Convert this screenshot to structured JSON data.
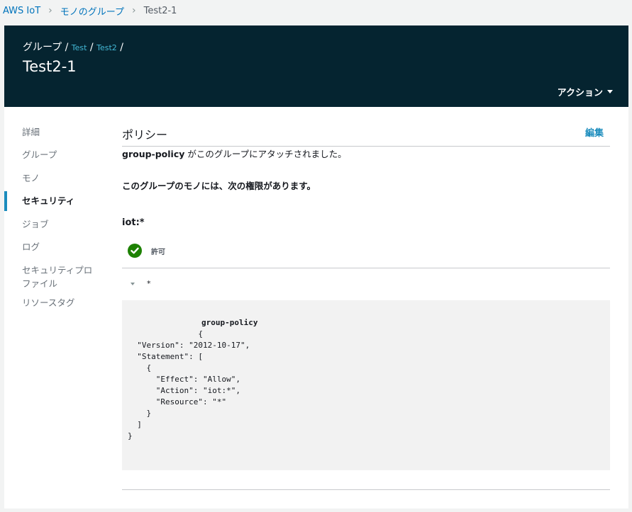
{
  "breadcrumb": {
    "items": [
      "AWS IoT",
      "モノのグループ"
    ],
    "current": "Test2-1"
  },
  "header": {
    "path_root": "グループ",
    "path_links": [
      "Test",
      "Test2"
    ],
    "title": "Test2-1",
    "actions_label": "アクション"
  },
  "sidenav": {
    "items": [
      "詳細",
      "グループ",
      "モノ",
      "セキュリティ",
      "ジョブ",
      "ログ",
      "セキュリティプロファイル",
      "リソースタグ"
    ],
    "active_index": 3
  },
  "policy": {
    "section_title": "ポリシー",
    "edit_label": "編集",
    "attached_name": "group-policy",
    "attached_text": " がこのグループにアタッチされました。",
    "permissions_heading": "このグループのモノには、次の権限があります。",
    "action": "iot:*",
    "effect_label": "許可",
    "resource": "*",
    "document_name": "group-policy",
    "document_body": "{\n  \"Version\": \"2012-10-17\",\n  \"Statement\": [\n    {\n      \"Effect\": \"Allow\",\n      \"Action\": \"iot:*\",\n      \"Resource\": \"*\"\n    }\n  ]\n}"
  },
  "colors": {
    "header_bg": "#052430",
    "link": "#0073bb",
    "active_bar": "#1b8cbd",
    "allow_green": "#1d8102"
  }
}
